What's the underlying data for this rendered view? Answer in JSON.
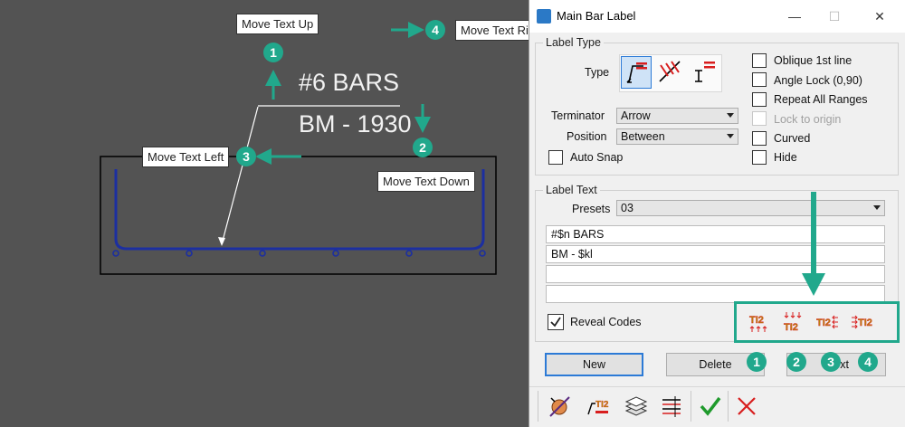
{
  "canvas": {
    "label_line1": "#6 BARS",
    "label_line2": "BM - 1930",
    "callouts": {
      "up": "Move Text Up",
      "right": "Move Text Right",
      "left": "Move Text Left",
      "down": "Move Text Down"
    },
    "markers": {
      "up": "1",
      "down": "2",
      "left": "3",
      "right": "4"
    },
    "accent_color": "#21a88c",
    "bar_color": "#1c2fa0"
  },
  "dialog": {
    "title": "Main Bar Label",
    "window_buttons": {
      "minimize": "—",
      "maximize": "☐",
      "close": "✕"
    },
    "label_type": {
      "group_title": "Label Type",
      "type_label": "Type",
      "terminator_label": "Terminator",
      "terminator_value": "Arrow",
      "position_label": "Position",
      "position_value": "Between",
      "auto_snap_label": "Auto Snap",
      "auto_snap_checked": false,
      "options": [
        {
          "label": "Oblique 1st line",
          "checked": false,
          "disabled": false
        },
        {
          "label": "Angle Lock (0,90)",
          "checked": false,
          "disabled": false
        },
        {
          "label": "Repeat All Ranges",
          "checked": false,
          "disabled": false
        },
        {
          "label": "Lock to origin",
          "checked": false,
          "disabled": true
        },
        {
          "label": "Curved",
          "checked": false,
          "disabled": false
        },
        {
          "label": "Hide",
          "checked": false,
          "disabled": false
        }
      ]
    },
    "label_text": {
      "group_title": "Label Text",
      "presets_label": "Presets",
      "presets_value": "03",
      "lines": [
        "#$n BARS",
        "BM - $kl",
        "",
        ""
      ],
      "reveal_codes_label": "Reveal Codes",
      "reveal_codes_checked": true,
      "move_buttons": [
        "move-text-up",
        "move-text-down",
        "move-text-left",
        "move-text-right"
      ],
      "move_button_markers": [
        "1",
        "2",
        "3",
        "4"
      ]
    },
    "buttons": {
      "new": "New",
      "delete": "Delete",
      "third_partial": "xt"
    },
    "bottom_toolbar_icons": [
      "bar-label-tool-icon",
      "label-text-icon",
      "stack-icon",
      "settings-lines-icon",
      "ok-check-icon",
      "cancel-x-icon"
    ]
  }
}
